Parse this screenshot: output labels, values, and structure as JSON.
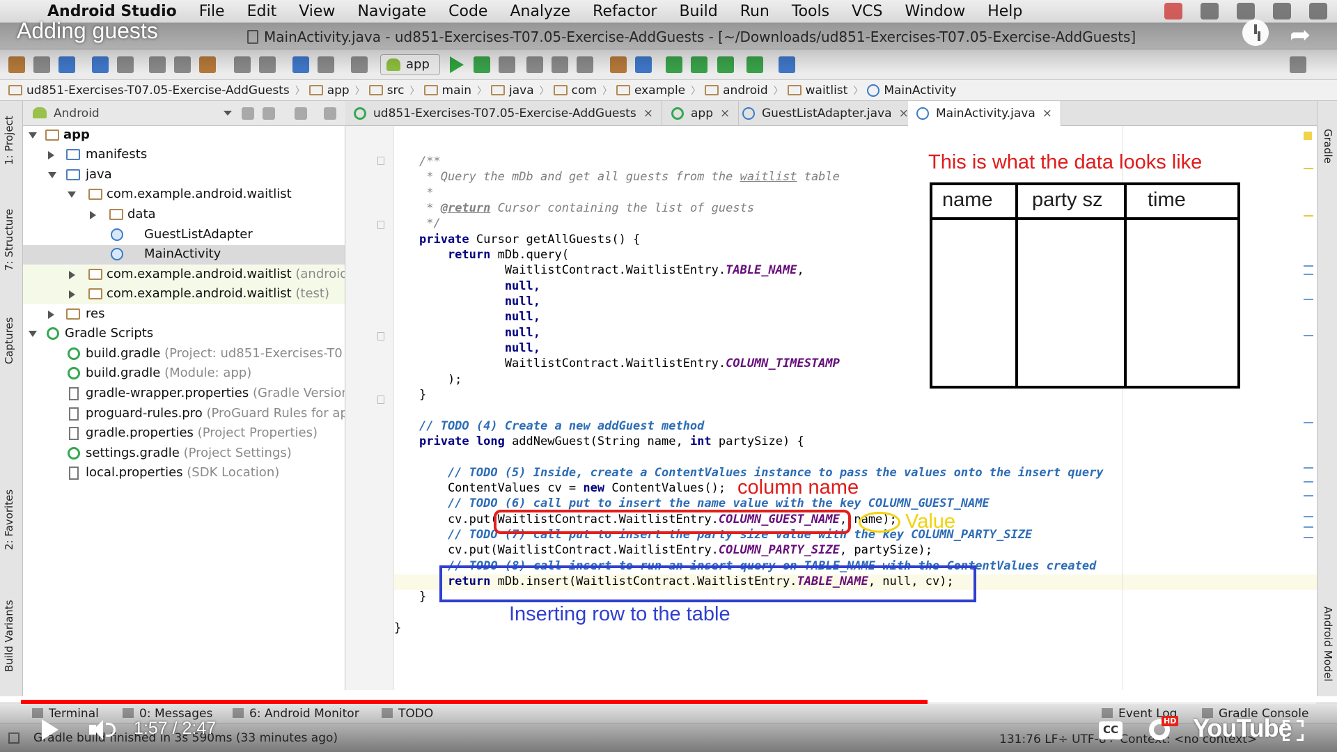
{
  "menubar": {
    "app_name": "Android Studio",
    "items": [
      "File",
      "Edit",
      "View",
      "Navigate",
      "Code",
      "Analyze",
      "Refactor",
      "Build",
      "Run",
      "Tools",
      "VCS",
      "Window",
      "Help"
    ]
  },
  "window": {
    "title": "MainActivity.java - ud851-Exercises-T07.05-Exercise-AddGuests - [~/Downloads/ud851-Exercises-T07.05-Exercise-AddGuests]"
  },
  "toolbar": {
    "run_config": "app"
  },
  "breadcrumb": [
    "ud851-Exercises-T07.05-Exercise-AddGuests",
    "app",
    "src",
    "main",
    "java",
    "com",
    "example",
    "android",
    "waitlist",
    "MainActivity"
  ],
  "left_stripe": {
    "tabs": [
      "1: Project",
      "7: Structure",
      "Captures",
      "2: Favorites",
      "Build Variants"
    ]
  },
  "right_stripe": {
    "tabs": [
      "Gradle",
      "Android Model"
    ]
  },
  "project_panel": {
    "view_mode": "Android",
    "tree": [
      {
        "label": "app",
        "hint": ""
      },
      {
        "label": "manifests",
        "hint": ""
      },
      {
        "label": "java",
        "hint": ""
      },
      {
        "label": "com.example.android.waitlist",
        "hint": ""
      },
      {
        "label": "data",
        "hint": ""
      },
      {
        "label": "GuestListAdapter",
        "hint": ""
      },
      {
        "label": "MainActivity",
        "hint": ""
      },
      {
        "label": "com.example.android.waitlist",
        "hint": "(androidT"
      },
      {
        "label": "com.example.android.waitlist",
        "hint": "(test)"
      },
      {
        "label": "res",
        "hint": ""
      },
      {
        "label": "Gradle Scripts",
        "hint": ""
      },
      {
        "label": "build.gradle",
        "hint": "(Project: ud851-Exercises-T0"
      },
      {
        "label": "build.gradle",
        "hint": "(Module: app)"
      },
      {
        "label": "gradle-wrapper.properties",
        "hint": "(Gradle Version"
      },
      {
        "label": "proguard-rules.pro",
        "hint": "(ProGuard Rules for ap"
      },
      {
        "label": "gradle.properties",
        "hint": "(Project Properties)"
      },
      {
        "label": "settings.gradle",
        "hint": "(Project Settings)"
      },
      {
        "label": "local.properties",
        "hint": "(SDK Location)"
      }
    ]
  },
  "editor_tabs": [
    {
      "label": "ud851-Exercises-T07.05-Exercise-AddGuests",
      "close": "×"
    },
    {
      "label": "app",
      "close": "×"
    },
    {
      "label": "GuestListAdapter.java",
      "close": "×"
    },
    {
      "label": "MainActivity.java",
      "close": "×"
    }
  ],
  "code": {
    "l01": "/**",
    "l02a": " * Query the mDb and get all guests from the ",
    "l02b": "waitlist",
    "l02c": " table",
    "l03": " *",
    "l04a": " * ",
    "l04b": "@return",
    "l04c": " Cursor containing the list of guests",
    "l05": " */",
    "l06a": "private",
    "l06b": " Cursor getAllGuests() {",
    "l07a": "    return",
    "l07b": " mDb.query(",
    "l08a": "            WaitlistContract.WaitlistEntry.",
    "l08b": "TABLE_NAME",
    "l08c": ",",
    "l09": "            null,",
    "l14a": "            WaitlistContract.WaitlistEntry.",
    "l14b": "COLUMN_TIMESTAMP",
    "l15": "    );",
    "l16": "}",
    "l18": "// TODO (4) Create a new addGuest method",
    "l19a": "private long",
    "l19b": " addNewGuest(String name, ",
    "l19c": "int",
    "l19d": " partySize) {",
    "l21": "    // TODO (5) Inside, create a ContentValues instance to pass the values onto the insert query",
    "l22a": "    ContentValues cv = ",
    "l22b": "new",
    "l22c": " ContentValues();",
    "l23": "    // TODO (6) call put to insert the name value with the key COLUMN_GUEST_NAME",
    "l24a": "    cv.put(WaitlistContract.WaitlistEntry.",
    "l24b": "COLUMN_GUEST_NAME",
    "l24c": ", name);",
    "l25": "    // TODO (7) call put to insert the party size value with the key COLUMN_PARTY_SIZE",
    "l26a": "    cv.put(WaitlistContract.WaitlistEntry.",
    "l26b": "COLUMN_PARTY_SIZE",
    "l26c": ", partySize);",
    "l27": "    // TODO (8) call insert to run an insert query on TABLE_NAME with the ContentValues created",
    "l28a": "    return",
    "l28b": " mDb.insert(WaitlistContract.WaitlistEntry.",
    "l28c": "TABLE_NAME",
    "l28d": ", null, cv);",
    "l29": "}",
    "l31": "}"
  },
  "annotations": {
    "table_title": "This is what the data looks like",
    "table_headers": [
      "name",
      "party sz",
      "time"
    ],
    "column_name": "column name",
    "value": "Value",
    "inserting_row": "Inserting row to the table",
    "colors": {
      "red": "#e01b1b",
      "yellow": "#f2d20a",
      "blue": "#2f3fd0"
    }
  },
  "bottom_tools": {
    "left": [
      "Terminal",
      "0: Messages",
      "6: Android Monitor",
      "TODO"
    ],
    "right": [
      "Event Log",
      "Gradle Console"
    ]
  },
  "statusbar": {
    "message": "Gradle build finished in 3s 590ms (33 minutes ago)",
    "position": "131:76  LF÷  UTF-8÷  Context: <no context>"
  },
  "video": {
    "title": "Adding guests",
    "time": "1:57 / 2:47",
    "progress": 0.7,
    "cc": "CC",
    "hd": "HD",
    "logo": "YouTube",
    "accent": "#ff0000"
  }
}
